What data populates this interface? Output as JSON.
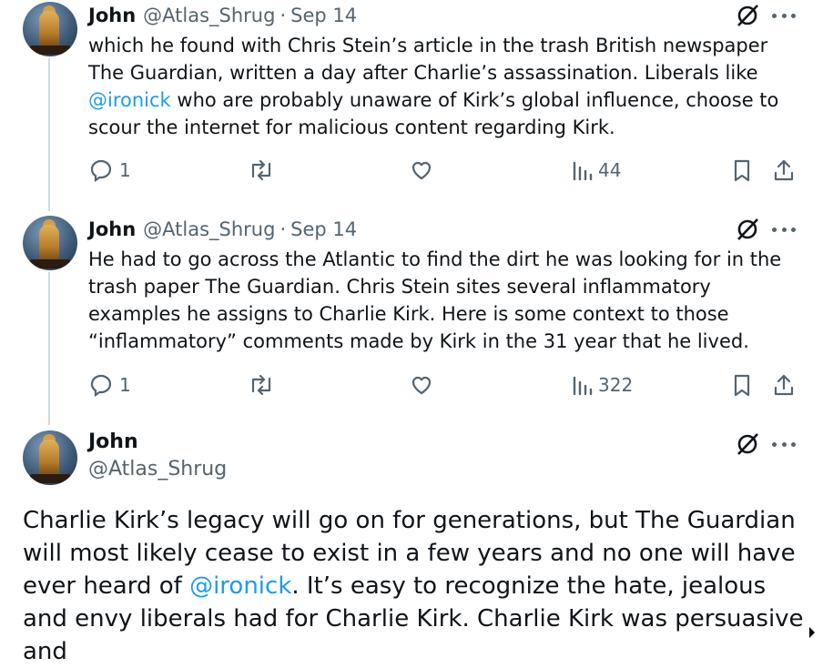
{
  "tweets": [
    {
      "name": "John",
      "handle": "@Atlas_Shrug",
      "date": "Sep 14",
      "text_1": "which he found with Chris Stein’s article in the trash British newspaper The Guardian, written a day after Charlie’s assassination. Liberals like ",
      "mention": "@ironick",
      "text_2": " who are probably unaware of Kirk’s global influence, choose to scour the internet for malicious content regarding Kirk.",
      "replies": "1",
      "views": "44"
    },
    {
      "name": "John",
      "handle": "@Atlas_Shrug",
      "date": "Sep 14",
      "text": "He had to go across the Atlantic to find the dirt he was looking for in the trash paper The Guardian.  Chris Stein sites several inflammatory examples he assigns to Charlie Kirk. Here is some context to those “inflammatory” comments made by Kirk in the 31 year that he lived.",
      "replies": "1",
      "views": "322"
    }
  ],
  "main_tweet": {
    "name": "John",
    "handle": "@Atlas_Shrug",
    "text_1": "Charlie Kirk’s legacy will go on for generations, but The Guardian will most likely cease to exist in a few years and no one will have ever heard of ",
    "mention": "@ironick",
    "text_2": ".  It’s easy to recognize the hate, jealous and envy liberals had for Charlie Kirk.  Charlie Kirk was persuasive and"
  },
  "separator": "·",
  "icons": [
    "grok-icon",
    "more-icon",
    "reply-icon",
    "retweet-icon",
    "like-icon",
    "views-icon",
    "bookmark-icon",
    "share-icon"
  ],
  "colors": {
    "accent": "#1d9bf0",
    "secondary_text": "#536471",
    "thread_line": "#cfd9de"
  }
}
